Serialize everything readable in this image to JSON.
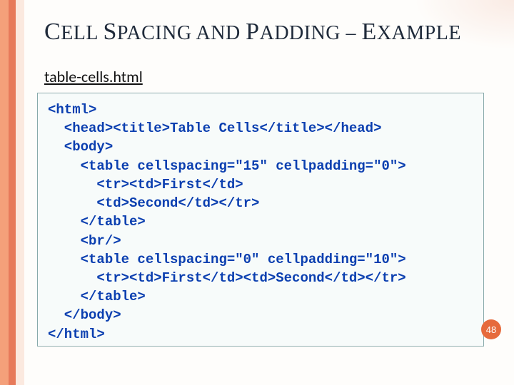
{
  "title_parts": {
    "cell": "C",
    "cell_rest": "ELL ",
    "spacing": "S",
    "spacing_rest": "PACING AND ",
    "padding": "P",
    "padding_rest": "ADDING ",
    "dash": "– ",
    "example": "E",
    "example_rest": "XAMPLE"
  },
  "filename": "table-cells.html",
  "code_lines": [
    "<html>",
    "  <head><title>Table Cells</title></head>",
    "  <body>",
    "    <table cellspacing=\"15\" cellpadding=\"0\">",
    "      <tr><td>First</td>",
    "      <td>Second</td></tr>",
    "    </table>",
    "    <br/>",
    "    <table cellspacing=\"0\" cellpadding=\"10\">",
    "      <tr><td>First</td><td>Second</td></tr>",
    "    </table>",
    "  </body>",
    "</html>"
  ],
  "page_number": "48"
}
